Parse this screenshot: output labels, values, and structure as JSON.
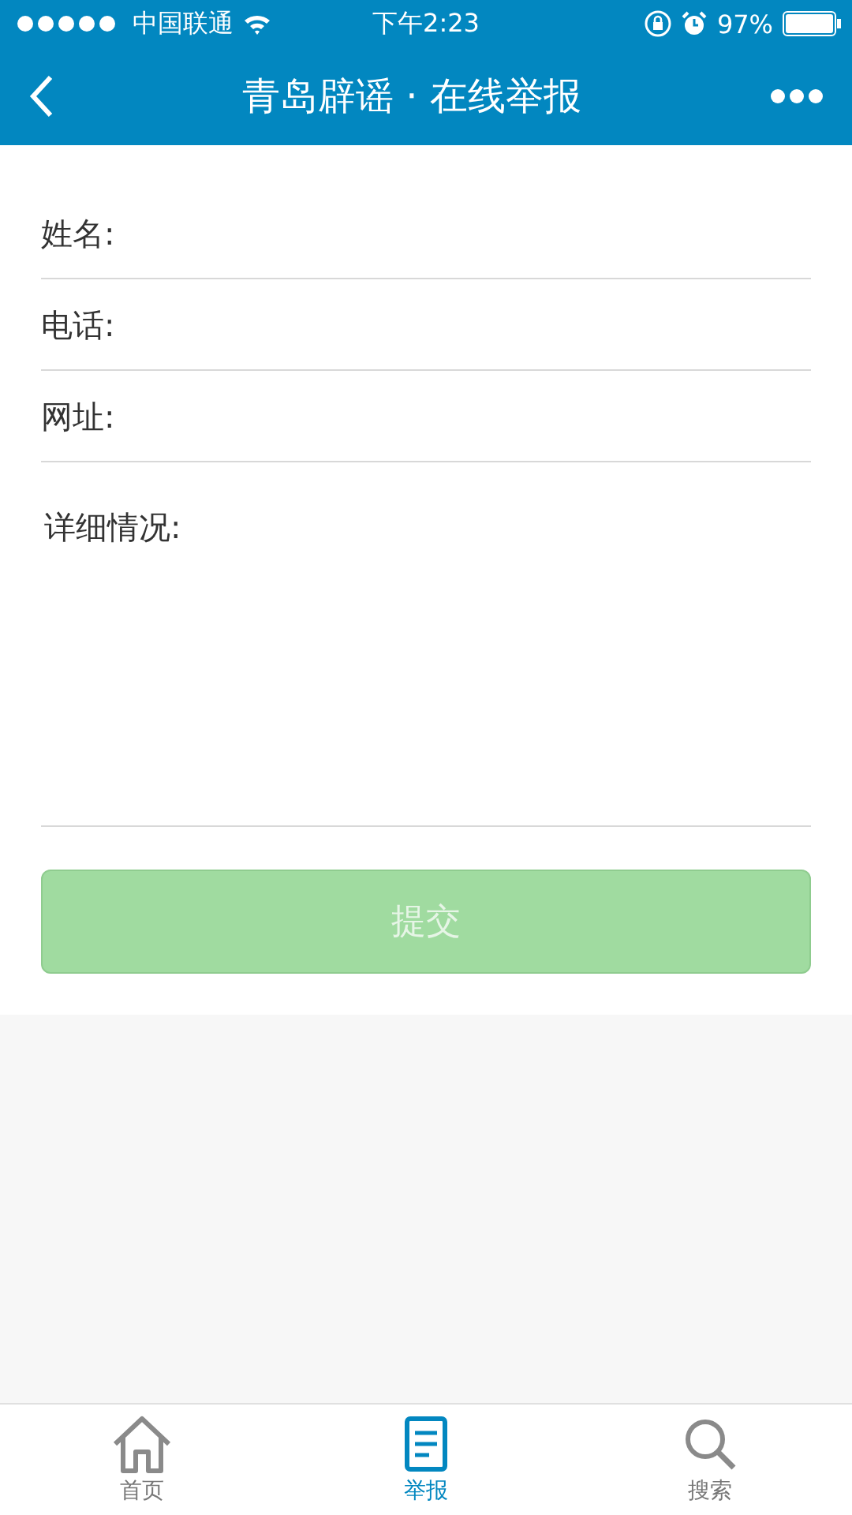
{
  "status_bar": {
    "carrier": "中国联通",
    "time": "下午2:23",
    "battery": "97%"
  },
  "nav_bar": {
    "title": "青岛辟谣 · 在线举报"
  },
  "form": {
    "fields": [
      {
        "label": "姓名:"
      },
      {
        "label": "电话:"
      },
      {
        "label": "网址:"
      }
    ],
    "details": {
      "label": "详细情况:"
    },
    "submit": {
      "label": "提交",
      "disabled": true
    }
  },
  "tab_bar": [
    {
      "label": "首页",
      "selected": false,
      "kind": "home"
    },
    {
      "label": "举报",
      "selected": true,
      "kind": "report"
    },
    {
      "label": "搜索",
      "selected": false,
      "kind": "search"
    }
  ]
}
